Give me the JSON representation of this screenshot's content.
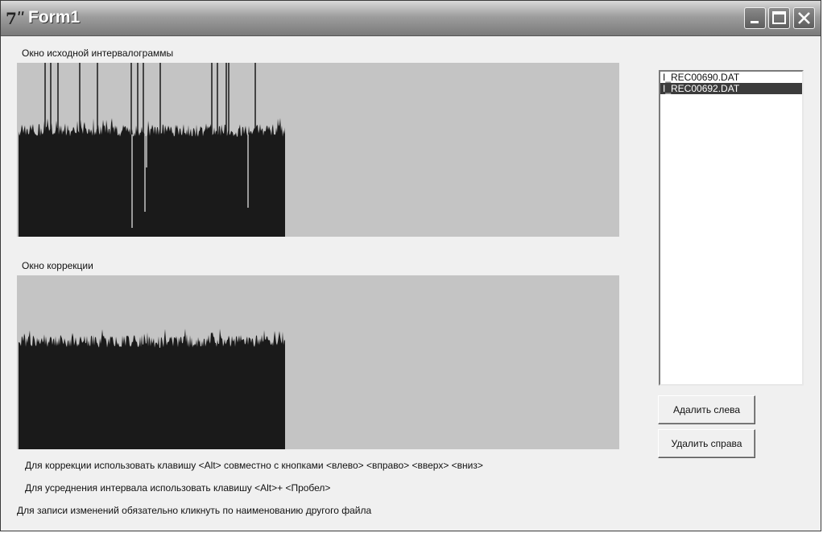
{
  "window": {
    "title": "Form1",
    "icon": "app-icon",
    "controls": [
      "minimize-icon",
      "maximize-icon",
      "close-icon"
    ]
  },
  "source_window": {
    "label": "Окно исходной интервалограммы"
  },
  "correction_window": {
    "label": "Окно коррекции"
  },
  "file_list": {
    "items": [
      "I_REC00690.DAT",
      "I_REC00692.DAT"
    ],
    "selected_index": 1
  },
  "buttons": {
    "delete_left": "Адалить слева",
    "delete_right": "Удалить справа"
  },
  "instructions": {
    "line1": "Для коррекции использовать клавишу <Alt>  совместно с кнопками <влево> <вправо> <вверх> <вниз>",
    "line2": "Для усреднения интервала  использовать клавишу <Alt>+ <Пробел>",
    "line3": "Для записи изменений обязательно кликнуть по наименованию другого файла"
  },
  "colors": {
    "panel_bg": "#c4c4c4",
    "plot_fill": "#1a1a1a",
    "selection": "#3c3c3c"
  }
}
